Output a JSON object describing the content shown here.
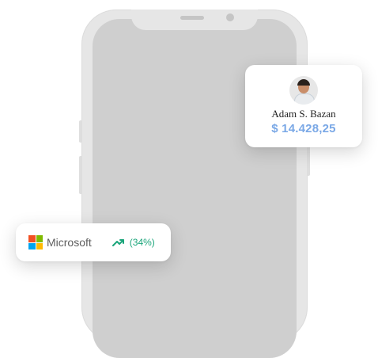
{
  "profile": {
    "name": "Adam S. Bazan",
    "amount": "$ 14.428,25"
  },
  "stock": {
    "company": "Microsoft",
    "change": "(34%)",
    "trend_icon": "trending-up-icon",
    "logo_colors": [
      "#f25022",
      "#7fba00",
      "#00a4ef",
      "#ffb900"
    ],
    "change_color": "#1aa57a"
  },
  "colors": {
    "amount": "#7aa8e6",
    "phone_frame": "#e6e6e6",
    "phone_screen": "#cfcfcf"
  }
}
